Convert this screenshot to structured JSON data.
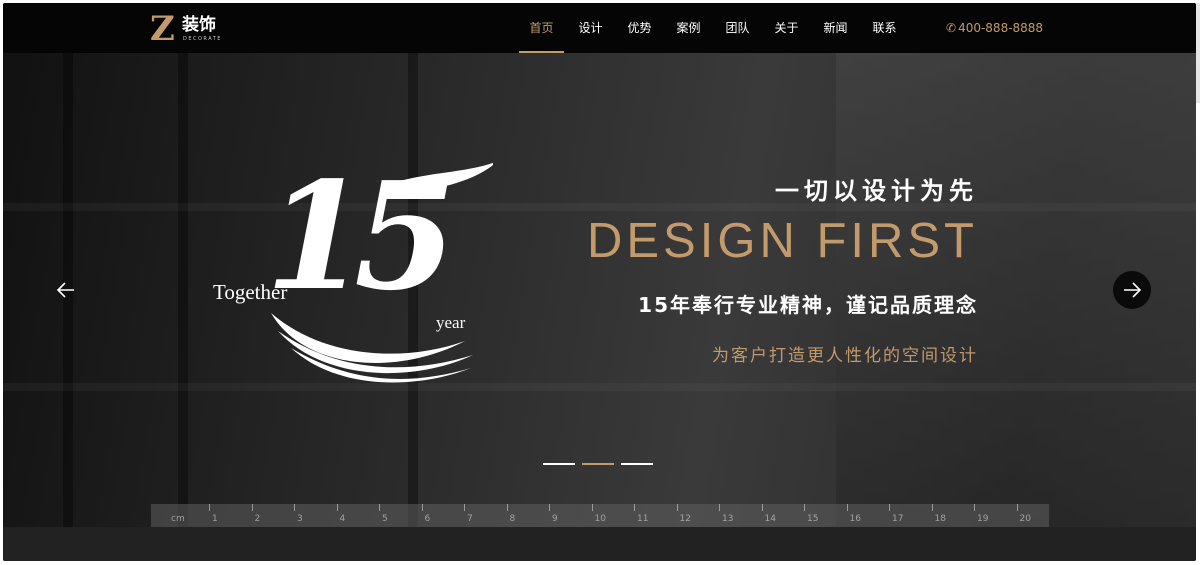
{
  "logo": {
    "mark": "Z",
    "name": "装饰",
    "subtitle": "DECORATE"
  },
  "nav": {
    "items": [
      {
        "label": "首页",
        "active": true
      },
      {
        "label": "设计",
        "active": false
      },
      {
        "label": "优势",
        "active": false
      },
      {
        "label": "案例",
        "active": false
      },
      {
        "label": "团队",
        "active": false
      },
      {
        "label": "关于",
        "active": false
      },
      {
        "label": "新闻",
        "active": false
      },
      {
        "label": "联系",
        "active": false
      }
    ]
  },
  "contact": {
    "phone_icon": "phone-icon",
    "phone": "400-888-8888"
  },
  "hero": {
    "emblem": {
      "number": "15",
      "left_text": "Together",
      "right_text": "year"
    },
    "slogan_cn": "一切以设计为先",
    "slogan_en": "DESIGN FIRST",
    "tagline": "15年奉行专业精神，谨记品质理念",
    "subtagline": "为客户打造更人性化的空间设计",
    "slides": 3,
    "active_slide": 2,
    "ruler": {
      "unit": "cm",
      "numbers": [
        "1",
        "2",
        "3",
        "4",
        "5",
        "6",
        "7",
        "8",
        "9",
        "10",
        "11",
        "12",
        "13",
        "14",
        "15",
        "16",
        "17",
        "18",
        "19",
        "20"
      ]
    }
  },
  "colors": {
    "accent": "#c29a6b",
    "header_bg": "#050505",
    "text": "#ffffff"
  }
}
